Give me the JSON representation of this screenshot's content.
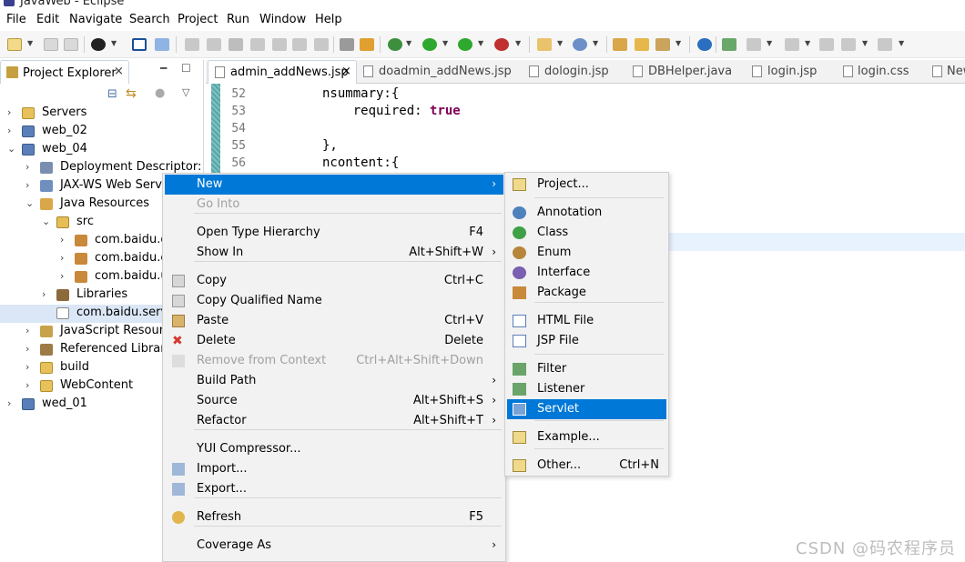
{
  "window": {
    "title": "JavaWeb - Eclipse"
  },
  "menubar": [
    "File",
    "Edit",
    "Navigate",
    "Search",
    "Project",
    "Run",
    "Window",
    "Help"
  ],
  "project_explorer": {
    "tab_label": "Project Explorer",
    "tree": [
      {
        "label": "Servers",
        "twisty": ">",
        "icon": "folder-icon"
      },
      {
        "label": "web_02",
        "twisty": ">",
        "icon": "web-project-icon"
      },
      {
        "label": "web_04",
        "twisty": "v",
        "icon": "web-project-icon"
      },
      {
        "label": "Deployment Descriptor: we",
        "twisty": ">",
        "icon": "deployment-descriptor-icon"
      },
      {
        "label": "JAX-WS Web Servic",
        "twisty": ">",
        "icon": "jaxws-icon"
      },
      {
        "label": "Java Resources",
        "twisty": "v",
        "icon": "java-resources-icon"
      },
      {
        "label": "src",
        "twisty": "v",
        "icon": "source-folder-icon"
      },
      {
        "label": "com.baidu.d",
        "twisty": ">",
        "icon": "package-icon"
      },
      {
        "label": "com.baidu.e",
        "twisty": ">",
        "icon": "package-icon"
      },
      {
        "label": "com.baidu.u",
        "twisty": ">",
        "icon": "package-icon"
      },
      {
        "label": "Libraries",
        "twisty": ">",
        "icon": "libraries-icon"
      },
      {
        "label": "com.baidu.servl",
        "twisty": "",
        "icon": "empty-package-icon"
      },
      {
        "label": "JavaScript Resourc",
        "twisty": ">",
        "icon": "javascript-resources-icon"
      },
      {
        "label": "Referenced Librarie",
        "twisty": ">",
        "icon": "referenced-libraries-icon"
      },
      {
        "label": "build",
        "twisty": ">",
        "icon": "folder-icon"
      },
      {
        "label": "WebContent",
        "twisty": ">",
        "icon": "folder-icon"
      },
      {
        "label": "wed_01",
        "twisty": ">",
        "icon": "web-project-icon"
      }
    ]
  },
  "editor": {
    "tabs": [
      "admin_addNews.jsp",
      "doadmin_addNews.jsp",
      "dologin.jsp",
      "DBHelper.java",
      "login.jsp",
      "login.css",
      "New"
    ],
    "active_tab_close": "×",
    "lines": [
      {
        "num": "52",
        "pre": "nsummary:{",
        "kw": "",
        "post": ""
      },
      {
        "num": "53",
        "pre": "    required: ",
        "kw": "true",
        "post": ""
      },
      {
        "num": "54",
        "pre": "",
        "kw": "",
        "post": ""
      },
      {
        "num": "55",
        "pre": "},",
        "kw": "",
        "post": ""
      },
      {
        "num": "56",
        "pre": "ncontent:{",
        "kw": "",
        "post": ""
      }
    ]
  },
  "context_menu": {
    "items": [
      {
        "label": "New",
        "shortcut": "",
        "arrow": "›",
        "state": "hover",
        "icon": ""
      },
      {
        "label": "Go Into",
        "shortcut": "",
        "arrow": "",
        "state": "disabled",
        "icon": ""
      },
      {
        "label": "Open Type Hierarchy",
        "shortcut": "F4",
        "arrow": "",
        "state": "",
        "icon": ""
      },
      {
        "label": "Show In",
        "shortcut": "Alt+Shift+W",
        "arrow": "›",
        "state": "",
        "icon": ""
      },
      {
        "label": "Copy",
        "shortcut": "Ctrl+C",
        "arrow": "",
        "state": "",
        "icon": "copy-icon"
      },
      {
        "label": "Copy Qualified Name",
        "shortcut": "",
        "arrow": "",
        "state": "",
        "icon": "copy-qualified-name-icon"
      },
      {
        "label": "Paste",
        "shortcut": "Ctrl+V",
        "arrow": "",
        "state": "",
        "icon": "paste-icon"
      },
      {
        "label": "Delete",
        "shortcut": "Delete",
        "arrow": "",
        "state": "",
        "icon": "delete-icon"
      },
      {
        "label": "Remove from Context",
        "shortcut": "Ctrl+Alt+Shift+Down",
        "arrow": "",
        "state": "disabled",
        "icon": "remove-context-icon"
      },
      {
        "label": "Build Path",
        "shortcut": "",
        "arrow": "›",
        "state": "",
        "icon": ""
      },
      {
        "label": "Source",
        "shortcut": "Alt+Shift+S",
        "arrow": "›",
        "state": "",
        "icon": ""
      },
      {
        "label": "Refactor",
        "shortcut": "Alt+Shift+T",
        "arrow": "›",
        "state": "",
        "icon": ""
      },
      {
        "label": "YUI Compressor...",
        "shortcut": "",
        "arrow": "",
        "state": "",
        "icon": ""
      },
      {
        "label": "Import...",
        "shortcut": "",
        "arrow": "",
        "state": "",
        "icon": "import-icon"
      },
      {
        "label": "Export...",
        "shortcut": "",
        "arrow": "",
        "state": "",
        "icon": "export-icon"
      },
      {
        "label": "Refresh",
        "shortcut": "F5",
        "arrow": "",
        "state": "",
        "icon": "refresh-icon"
      },
      {
        "label": "Coverage As",
        "shortcut": "",
        "arrow": "›",
        "state": "",
        "icon": ""
      }
    ]
  },
  "new_submenu": {
    "items": [
      {
        "label": "Project...",
        "shortcut": "",
        "state": "",
        "icon": "new-project-icon"
      },
      {
        "label": "Annotation",
        "shortcut": "",
        "state": "",
        "icon": "annotation-icon"
      },
      {
        "label": "Class",
        "shortcut": "",
        "state": "",
        "icon": "class-icon"
      },
      {
        "label": "Enum",
        "shortcut": "",
        "state": "",
        "icon": "enum-icon"
      },
      {
        "label": "Interface",
        "shortcut": "",
        "state": "",
        "icon": "interface-icon"
      },
      {
        "label": "Package",
        "shortcut": "",
        "state": "",
        "icon": "package-icon"
      },
      {
        "label": "HTML File",
        "shortcut": "",
        "state": "",
        "icon": "html-file-icon"
      },
      {
        "label": "JSP File",
        "shortcut": "",
        "state": "",
        "icon": "jsp-file-icon"
      },
      {
        "label": "Filter",
        "shortcut": "",
        "state": "",
        "icon": "filter-icon"
      },
      {
        "label": "Listener",
        "shortcut": "",
        "state": "",
        "icon": "listener-icon"
      },
      {
        "label": "Servlet",
        "shortcut": "",
        "state": "hover",
        "icon": "servlet-icon"
      },
      {
        "label": "Example...",
        "shortcut": "",
        "state": "",
        "icon": "example-icon"
      },
      {
        "label": "Other...",
        "shortcut": "Ctrl+N",
        "state": "",
        "icon": "other-icon"
      }
    ]
  },
  "watermark": "CSDN @码农程序员",
  "colors": {
    "selection": "#0078d7",
    "keyword": "#7f0055",
    "menu_bg": "#f2f2f2"
  }
}
